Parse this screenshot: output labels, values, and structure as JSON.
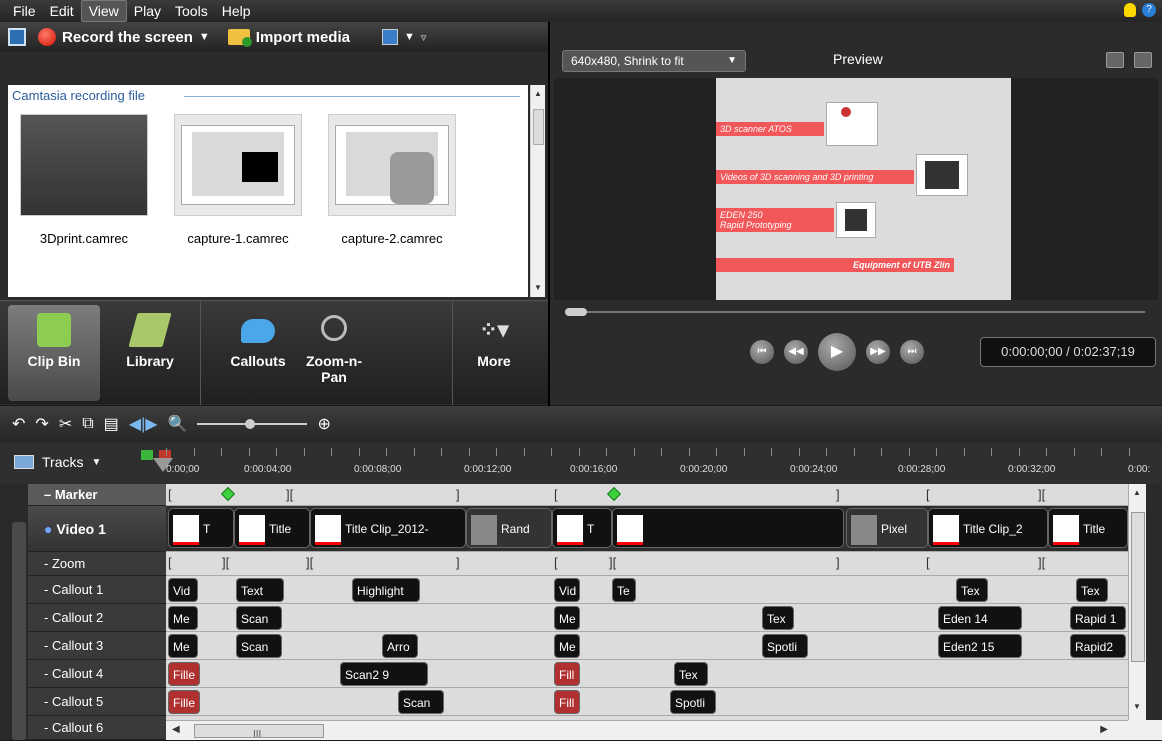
{
  "menu": {
    "items": [
      "File",
      "Edit",
      "View",
      "Play",
      "Tools",
      "Help"
    ]
  },
  "toolbar": {
    "record": "Record the screen",
    "import": "Import media"
  },
  "clipbin": {
    "heading": "Camtasia recording file",
    "files": [
      "3Dprint.camrec",
      "capture-1.camrec",
      "capture-2.camrec"
    ]
  },
  "tabs": {
    "items": [
      "Clip Bin",
      "Library",
      "Callouts",
      "Zoom-n-\nPan",
      "More"
    ]
  },
  "preview": {
    "size": "640x480, Shrink to fit",
    "label": "Preview",
    "time": "0:00:00;00 / 0:02:37;19",
    "slides": [
      "3D scanner ATOS",
      "Videos of 3D scanning and 3D printing",
      "EDEN 250\nRapid Prototyping",
      "Equipment of UTB Zlin"
    ]
  },
  "timeline": {
    "tracks_label": "Tracks",
    "ruler": [
      "0:00;00",
      "0:00:04;00",
      "0:00:08;00",
      "0:00:12;00",
      "0:00:16;00",
      "0:00:20;00",
      "0:00:24;00",
      "0:00:28;00",
      "0:00:32;00",
      "0:00:"
    ],
    "rows": [
      "Marker",
      "Video 1",
      "Zoom",
      "Callout 1",
      "Callout 2",
      "Callout 3",
      "Callout 4",
      "Callout 5",
      "Callout 6"
    ],
    "video_clips": [
      "T",
      "Title",
      "Title Clip_2012-",
      "Rand",
      "T",
      "Pixel",
      "Title Clip_2",
      "Title"
    ],
    "callout1": [
      "Vid",
      "Text",
      "Highlight",
      "Vid",
      "Te",
      "Tex",
      "Tex"
    ],
    "callout2": [
      "Me",
      "Scan",
      "Me",
      "Tex",
      "Eden 14",
      "Rapid 1"
    ],
    "callout3": [
      "Me",
      "Scan",
      "Arro",
      "Me",
      "Spotli",
      "Eden2 15",
      "Rapid2"
    ],
    "callout4": [
      "Fille",
      "Scan2 9",
      "Fill",
      "Tex"
    ],
    "callout5": [
      "Fille",
      "Scan",
      "Fill",
      "Spotli"
    ]
  },
  "scroll": {
    "hthumb_label": "III"
  }
}
